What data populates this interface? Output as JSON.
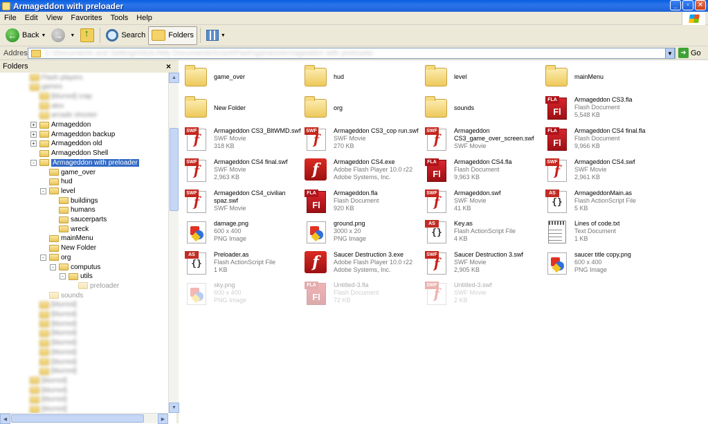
{
  "window": {
    "title": "Armageddon with preloader",
    "min_label": "_",
    "max_label": "▫",
    "close_label": "✕"
  },
  "menu": [
    "File",
    "Edit",
    "View",
    "Favorites",
    "Tools",
    "Help"
  ],
  "toolbar": {
    "back_label": "Back",
    "search_label": "Search",
    "folders_label": "Folders"
  },
  "address": {
    "label": "Address",
    "path": "C:\\Documents and Settings\\NickJ\\My Documents\\Grant\\Flash\\games\\Armageddon with preloader",
    "go_label": "Go"
  },
  "folders_pane": {
    "title": "Folders",
    "close_label": "×",
    "tree": [
      {
        "label": "Flash players",
        "level": 3,
        "blurred": true
      },
      {
        "label": "games",
        "level": 3,
        "blurred": true
      },
      {
        "label": "[blurred] crap",
        "level": 4,
        "blurred": true
      },
      {
        "label": "alex",
        "level": 4,
        "blurred": true
      },
      {
        "label": "arcade shooter",
        "level": 4,
        "blurred": true
      },
      {
        "label": "Armageddon",
        "level": 4,
        "expander": "+"
      },
      {
        "label": "Armageddon backup",
        "level": 4,
        "expander": "+"
      },
      {
        "label": "Armageddon old",
        "level": 4,
        "expander": "+"
      },
      {
        "label": "Armageddon Shell",
        "level": 4
      },
      {
        "label": "Armageddon with preloader",
        "level": 4,
        "expander": "-",
        "selected": true
      },
      {
        "label": "game_over",
        "level": 5
      },
      {
        "label": "hud",
        "level": 5
      },
      {
        "label": "level",
        "level": 5,
        "expander": "-"
      },
      {
        "label": "buildings",
        "level": 6
      },
      {
        "label": "humans",
        "level": 6
      },
      {
        "label": "saucerparts",
        "level": 6
      },
      {
        "label": "wreck",
        "level": 6
      },
      {
        "label": "mainMenu",
        "level": 5
      },
      {
        "label": "New Folder",
        "level": 5
      },
      {
        "label": "org",
        "level": 5,
        "expander": "-"
      },
      {
        "label": "computus",
        "level": 6,
        "expander": "-"
      },
      {
        "label": "utils",
        "level": 7,
        "expander": "-"
      },
      {
        "label": "preloader",
        "level": 8,
        "faded": true
      },
      {
        "label": "sounds",
        "level": 5,
        "faded": true
      },
      {
        "label": "[blurred]",
        "level": 4,
        "blurred": true
      },
      {
        "label": "[blurred]",
        "level": 4,
        "blurred": true
      },
      {
        "label": "[blurred]",
        "level": 4,
        "blurred": true
      },
      {
        "label": "[blurred]",
        "level": 4,
        "blurred": true
      },
      {
        "label": "[blurred]",
        "level": 4,
        "blurred": true
      },
      {
        "label": "[blurred]",
        "level": 4,
        "blurred": true
      },
      {
        "label": "[blurred]",
        "level": 4,
        "blurred": true
      },
      {
        "label": "[blurred]",
        "level": 4,
        "blurred": true
      },
      {
        "label": "[blurred]",
        "level": 3,
        "blurred": true
      },
      {
        "label": "[blurred]",
        "level": 3,
        "blurred": true
      },
      {
        "label": "[blurred]",
        "level": 3,
        "blurred": true
      },
      {
        "label": "[blurred]",
        "level": 3,
        "blurred": true
      },
      {
        "label": "[blurred]",
        "level": 3,
        "blurred": true
      },
      {
        "label": "[blurred]",
        "level": 3,
        "blurred": true
      }
    ]
  },
  "files": [
    {
      "name": "game_over",
      "type": "folder"
    },
    {
      "name": "hud",
      "type": "folder"
    },
    {
      "name": "level",
      "type": "folder"
    },
    {
      "name": "mainMenu",
      "type": "folder"
    },
    {
      "name": "New Folder",
      "type": "folder"
    },
    {
      "name": "org",
      "type": "folder"
    },
    {
      "name": "sounds",
      "type": "folder"
    },
    {
      "name": "Armageddon CS3.fla",
      "type": "fla",
      "line2": "Flash Document",
      "line3": "5,548 KB"
    },
    {
      "name": "Armageddon CS3_BltWMD.swf",
      "type": "swf",
      "line2": "SWF Movie",
      "line3": "318 KB"
    },
    {
      "name": "Armageddon CS3_cop run.swf",
      "type": "swf",
      "line2": "SWF Movie",
      "line3": "270 KB"
    },
    {
      "name": "Armageddon CS3_game_over_screen.swf",
      "type": "swf",
      "line2": "SWF Movie",
      "line3": ""
    },
    {
      "name": "Armageddon CS4 final.fla",
      "type": "fla",
      "line2": "Flash Document",
      "line3": "9,966 KB"
    },
    {
      "name": "Armageddon CS4 final.swf",
      "type": "swf",
      "line2": "SWF Movie",
      "line3": "2,963 KB"
    },
    {
      "name": "Armageddon CS4.exe",
      "type": "exe",
      "line2": "Adobe Flash Player 10.0 r22",
      "line3": "Adobe Systems, Inc."
    },
    {
      "name": "Armageddon CS4.fla",
      "type": "fla",
      "line2": "Flash Document",
      "line3": "9,963 KB"
    },
    {
      "name": "Armageddon CS4.swf",
      "type": "swf",
      "line2": "SWF Movie",
      "line3": "2,961 KB"
    },
    {
      "name": "Armageddon CS4_civilian spaz.swf",
      "type": "swf",
      "line2": "SWF Movie",
      "line3": ""
    },
    {
      "name": "Armageddon.fla",
      "type": "fla",
      "line2": "Flash Document",
      "line3": "920 KB"
    },
    {
      "name": "Armageddon.swf",
      "type": "swf",
      "line2": "SWF Movie",
      "line3": "41 KB"
    },
    {
      "name": "ArmageddonMain.as",
      "type": "as",
      "line2": "Flash ActionScript File",
      "line3": "5 KB"
    },
    {
      "name": "damage.png",
      "type": "png",
      "line2": "600 x 400",
      "line3": "PNG Image"
    },
    {
      "name": "ground.png",
      "type": "png",
      "line2": "3000 x 20",
      "line3": "PNG Image"
    },
    {
      "name": "Key.as",
      "type": "as",
      "line2": "Flash ActionScript File",
      "line3": "4 KB"
    },
    {
      "name": "Lines of code.txt",
      "type": "txt",
      "line2": "Text Document",
      "line3": "1 KB"
    },
    {
      "name": "Preloader.as",
      "type": "as",
      "line2": "Flash ActionScript File",
      "line3": "1 KB"
    },
    {
      "name": "Saucer Destruction 3.exe",
      "type": "exe",
      "line2": "Adobe Flash Player 10.0 r22",
      "line3": "Adobe Systems, Inc."
    },
    {
      "name": "Saucer Destruction 3.swf",
      "type": "swf",
      "line2": "SWF Movie",
      "line3": "2,905 KB"
    },
    {
      "name": "saucer title copy.png",
      "type": "png",
      "line2": "600 x 400",
      "line3": "PNG Image"
    },
    {
      "name": "sky.png",
      "type": "png",
      "line2": "600 x 400",
      "line3": "PNG Image",
      "faded": true
    },
    {
      "name": "Untitled-3.fla",
      "type": "fla",
      "line2": "Flash Document",
      "line3": "72 KB",
      "faded": true
    },
    {
      "name": "Untitled-3.swf",
      "type": "swf",
      "line2": "SWF Movie",
      "line3": "2 KB",
      "faded": true
    }
  ]
}
